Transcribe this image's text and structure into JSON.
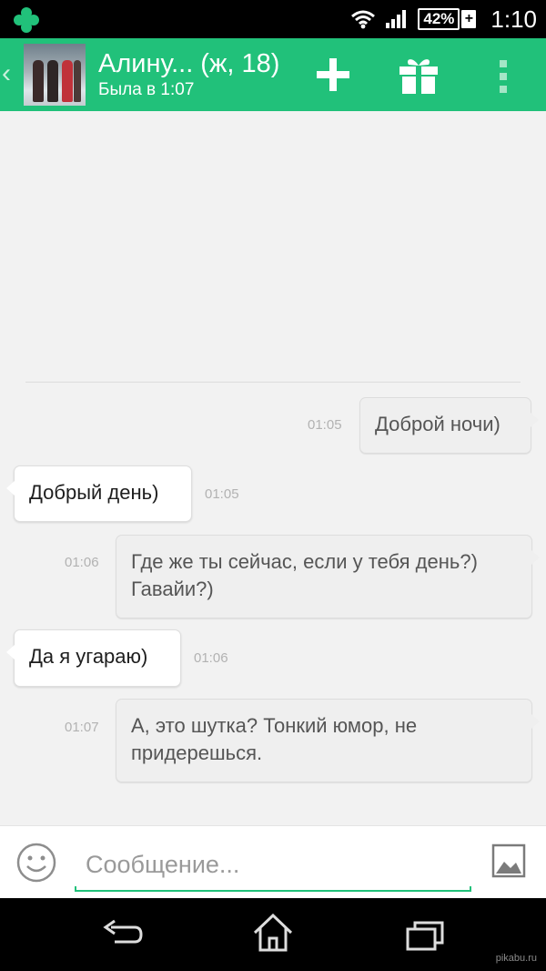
{
  "status_bar": {
    "battery": "42%",
    "battery_charging": "+",
    "time": "1:10",
    "icons": [
      "app-logo-icon",
      "wifi-icon",
      "cell-signal-icon",
      "battery-icon"
    ]
  },
  "header": {
    "back": "‹",
    "title": "Алину... (ж, 18)",
    "subtitle": "Была  в 1:07",
    "actions": [
      "add-icon",
      "gift-icon",
      "more-vert-icon"
    ]
  },
  "messages": [
    {
      "side": "out",
      "text": "Доброй ночи)",
      "time": "01:05"
    },
    {
      "side": "in",
      "text": "Добрый день)",
      "time": "01:05"
    },
    {
      "side": "out",
      "text": "Где же ты сейчас, если у тебя день?) Гавайи?)",
      "time": "01:06"
    },
    {
      "side": "in",
      "text": "Да я угараю)",
      "time": "01:06"
    },
    {
      "side": "out",
      "text": "А, это шутка? Тонкий юмор, не придерешься.",
      "time": "01:07"
    }
  ],
  "composer": {
    "placeholder": "Сообщение...",
    "value": ""
  },
  "watermark": "pikabu.ru",
  "colors": {
    "accent": "#21c17a",
    "chat_background": "#f2f2f2",
    "outgoing_bubble": "#efefef",
    "incoming_bubble": "#ffffff"
  }
}
